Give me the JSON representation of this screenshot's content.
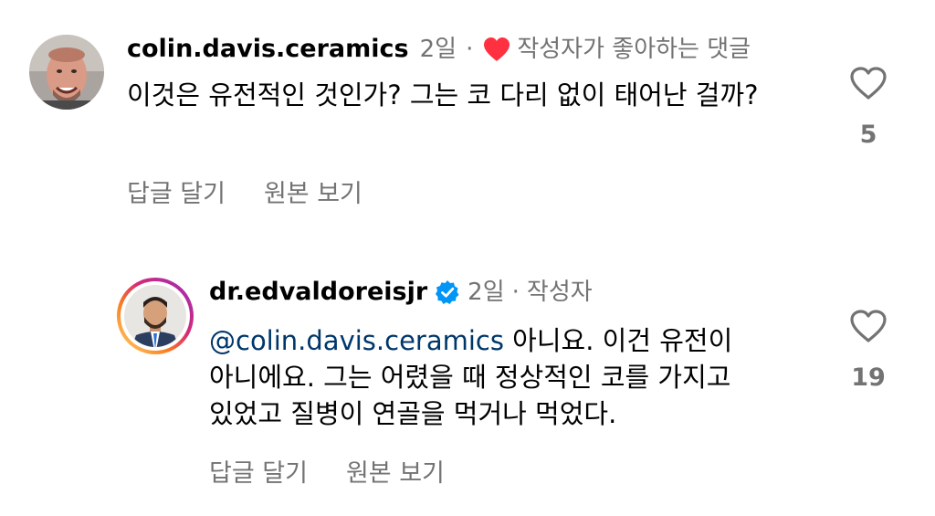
{
  "comments": [
    {
      "username": "colin.davis.ceramics",
      "time": "2일",
      "separator": "·",
      "author_liked": "작성자가 좋아하는 댓글",
      "text": "이것은 유전적인 것인가? 그는 코 다리 없이 태어난 걸까?",
      "reply_label": "답글 달기",
      "original_label": "원본 보기",
      "like_count": "5",
      "avatar_icon": "profile-photo-colin",
      "liked_heart_color": "#ff3040"
    },
    {
      "username": "dr.edvaldoreisjr",
      "verified": true,
      "verified_color": "#0095f6",
      "time": "2일",
      "separator": "·",
      "author_badge": "작성자",
      "mention": "@colin.davis.ceramics",
      "text": " 아니요. 이건 유전이 아니에요. 그는 어렸을 때 정상적인 코를 가지고 있었고 질병이 연골을 먹거나 먹었다.",
      "reply_label": "답글 달기",
      "original_label": "원본 보기",
      "like_count": "19",
      "avatar_icon": "profile-photo-edvaldo",
      "story_ring": true
    }
  ]
}
